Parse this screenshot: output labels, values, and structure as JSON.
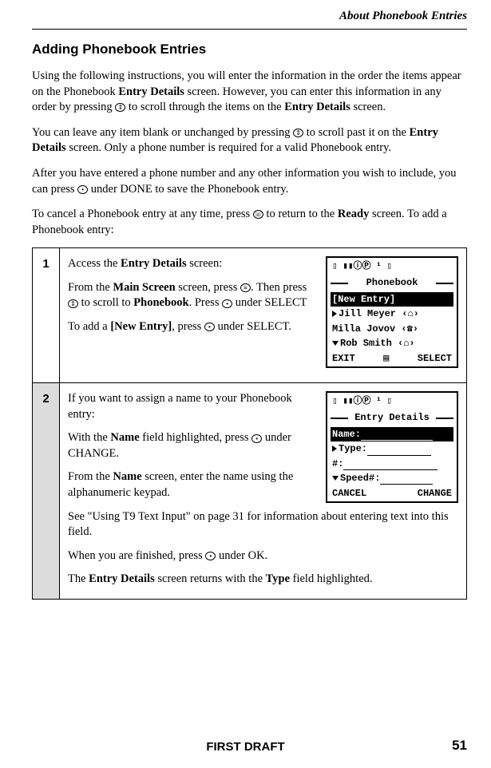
{
  "header": {
    "chapter": "About Phonebook Entries"
  },
  "section": {
    "title": "Adding Phonebook Entries"
  },
  "paragraphs": {
    "p1a": "Using the following instructions, you will enter the information in the order the items appear on the Phonebook ",
    "p1b": "Entry Details",
    "p1c": " screen. However, you can enter this information in any order by pressing ",
    "p1d": " to scroll through the items on the ",
    "p1e": "Entry Details",
    "p1f": " screen.",
    "p2a": "You can leave any item blank or unchanged by pressing ",
    "p2b": " to scroll past it on the ",
    "p2c": "Entry Details",
    "p2d": " screen. Only a phone number is required for a valid Phonebook entry.",
    "p3a": "After you have entered a phone number and any other information you wish to include, you can press ",
    "p3b": " under DONE to save the Phonebook entry.",
    "p4a": "To cancel a Phonebook entry at any time, press ",
    "p4b": " to return to the ",
    "p4c": "Ready",
    "p4d": " screen. To add a Phonebook entry:"
  },
  "steps": {
    "s1": {
      "num": "1",
      "l1a": "Access the ",
      "l1b": "Entry Details",
      "l1c": " screen:",
      "l2a": "From the ",
      "l2b": "Main Screen",
      "l2c": " screen, press ",
      "l2d": ". Then press ",
      "l2e": " to scroll to ",
      "l2f": "Phonebook",
      "l2g": ". Press ",
      "l2h": " under SELECT",
      "l3a": "To add a ",
      "l3b": "[New Entry]",
      "l3c": ", press ",
      "l3d": " under SELECT."
    },
    "s2": {
      "num": "2",
      "l1": "If you want to assign a name to your Phonebook entry:",
      "l2a": "With the ",
      "l2b": "Name",
      "l2c": " field highlighted, press ",
      "l2d": " under CHANGE.",
      "l3a": "From the ",
      "l3b": "Name",
      "l3c": " screen, enter the name using the alphanumeric keypad.",
      "l4": "See \"Using T9 Text Input\" on page 31 for information about entering text into this field.",
      "l5a": "When you are finished, press ",
      "l5b": " under OK.",
      "l6a": "The ",
      "l6b": "Entry Details",
      "l6c": " screen returns with the ",
      "l6d": "Type",
      "l6e": " field highlighted."
    }
  },
  "phone1": {
    "title": "Phonebook",
    "line1": "[New Entry]",
    "line2": "Jill Meyer ‹⌂›",
    "line3": "Milla Jovov ‹☎›",
    "line4": "Rob Smith  ‹⌂›",
    "sk_left": "EXIT",
    "sk_right": "SELECT",
    "status": "▯ ▮▮ⓘⓅ     ¹    ▯"
  },
  "phone2": {
    "title": "Entry Details",
    "f1": "Name:",
    "f2": "Type:",
    "f3": "#:",
    "f4": "Speed#:",
    "sk_left": "CANCEL",
    "sk_right": "CHANGE",
    "status": "▯ ▮▮ⓘⓅ     ¹    ▯"
  },
  "icons": {
    "scroll": "⇕",
    "dot": "•",
    "menu": "≡",
    "end": "☏"
  },
  "footer": {
    "draft": "FIRST DRAFT",
    "page": "51"
  }
}
